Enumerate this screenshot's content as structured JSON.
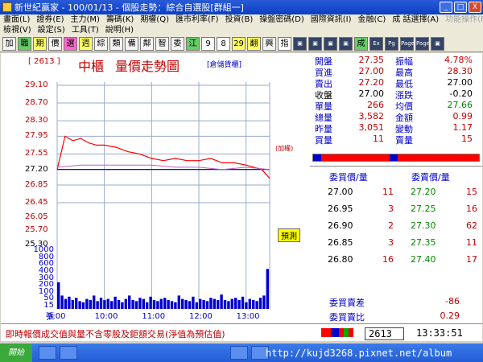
{
  "window": {
    "title": "新世紀贏家 - 100/01/13 - 個股走勢：綜合自選股[群組一]",
    "buttons": {
      "minimize": "_",
      "restore": "□",
      "close": "X"
    }
  },
  "menubar": {
    "row1": [
      "畫面(L)",
      "證券(E)",
      "主力(M)",
      "籌碼(K)",
      "期權(Q)",
      "匯市利率(F)",
      "投資(B)",
      "操盤密碼(D)",
      "國際資訊(I)",
      "金融(C)",
      "成 話選擇(A)",
      "功能操作(F)"
    ],
    "row2": [
      "檢視(V)",
      "設定(S)",
      "工具(T)",
      "說明(H)"
    ]
  },
  "toolbar": {
    "buttons": [
      "加",
      "職",
      "期",
      "價",
      "選",
      "週",
      "綜",
      "類",
      "備",
      "鄰",
      "智",
      "委",
      "江",
      "9",
      "8",
      "29",
      "翻",
      "興",
      "指",
      "▣",
      "▣",
      "▣",
      "▣",
      "成",
      "Ex",
      "Pg",
      "Page",
      "Page",
      "▣"
    ]
  },
  "chart": {
    "stock_code": "[ 2613 ]",
    "stock_name": "中櫃",
    "label": "量價走勢圖",
    "group_tag": "[倉儲貨櫃]",
    "plus_label": "(加權)",
    "estimate_badge": "預測",
    "volume_unit": "張"
  },
  "chart_data": {
    "type": "line",
    "price_ylim": [
      26.45,
      29.1
    ],
    "price_ticks": [
      "29.10",
      "28.70",
      "28.30",
      "27.95",
      "27.55",
      "27.20",
      "26.85",
      "26.45",
      "26.05",
      "25.70",
      "25.30"
    ],
    "reference_price": 27.2,
    "volume_ticks": [
      "1000",
      "800",
      "600",
      "400",
      "300",
      "200",
      "100",
      "50",
      "15"
    ],
    "x_ticks": [
      "9:00",
      "10:00",
      "11:00",
      "12:00",
      "13:00"
    ],
    "series": [
      {
        "name": "price",
        "color": "#ff0000",
        "x": [
          "9:00",
          "9:10",
          "9:20",
          "9:30",
          "9:40",
          "9:50",
          "10:00",
          "10:15",
          "10:30",
          "10:45",
          "11:00",
          "11:15",
          "11:30",
          "11:45",
          "12:00",
          "12:15",
          "12:30",
          "12:45",
          "13:00",
          "13:10",
          "13:20",
          "13:25",
          "13:30"
        ],
        "values": [
          27.2,
          27.95,
          27.85,
          27.9,
          27.8,
          27.75,
          27.75,
          27.7,
          27.6,
          27.55,
          27.45,
          27.4,
          27.45,
          27.4,
          27.4,
          27.45,
          27.35,
          27.35,
          27.3,
          27.25,
          27.2,
          27.1,
          27.0
        ]
      },
      {
        "name": "index",
        "color": "#c060c0",
        "x": [
          "9:00",
          "9:30",
          "10:00",
          "10:30",
          "11:00",
          "11:30",
          "12:00",
          "12:30",
          "13:00",
          "13:30"
        ],
        "values": [
          27.25,
          27.3,
          27.3,
          27.3,
          27.3,
          27.25,
          27.25,
          27.2,
          27.25,
          27.2
        ]
      }
    ],
    "volume_values": [
      120,
      60,
      45,
      55,
      40,
      50,
      35,
      30,
      45,
      40,
      60,
      35,
      50,
      40,
      45,
      35,
      55,
      40,
      30,
      45,
      60,
      40,
      35,
      50,
      45,
      30,
      55,
      40,
      35,
      45,
      50,
      40,
      35,
      30,
      60,
      45,
      40,
      35,
      55,
      30,
      45,
      40,
      35,
      50,
      45,
      40,
      65,
      40,
      35,
      45,
      50,
      40,
      55,
      30,
      45,
      40,
      35,
      50,
      60,
      180
    ]
  },
  "quote": {
    "rows": [
      {
        "l1": "開盤",
        "v1": "27.35",
        "l2": "振幅",
        "v2": "4.78%",
        "c2": "#c00000"
      },
      {
        "l1": "買進",
        "v1": "27.00",
        "l2": "最高",
        "v2": "28.30",
        "c2": "#c00000"
      },
      {
        "l1": "賣出",
        "v1": "27.20",
        "l2": "最低",
        "v2": "27.00",
        "c2": "#000000"
      },
      {
        "l1": "收盤",
        "v1": "27.00",
        "l2": "漲跌",
        "v2": "-0.20",
        "c2": "#000000"
      },
      {
        "l1": "單量",
        "v1": "266",
        "l2": "均價",
        "v2": "27.66",
        "c2": "#008800"
      },
      {
        "l1": "總量",
        "v1": "3,582",
        "l2": "金額",
        "v2": "0.99",
        "c2": "#c00000"
      },
      {
        "l1": "昨量",
        "v1": "3,051",
        "l2": "變動",
        "v2": "1.17",
        "c2": "#c00000"
      },
      {
        "l1": "買量",
        "v1": "11",
        "l2": "賣量",
        "v2": "15",
        "c2": "#c00000"
      }
    ],
    "bid_header": "委買價/量",
    "ask_header": "委賣價/量",
    "bids": [
      {
        "p": "27.00",
        "v": "11"
      },
      {
        "p": "26.95",
        "v": "3"
      },
      {
        "p": "26.90",
        "v": "2"
      },
      {
        "p": "26.85",
        "v": "3"
      },
      {
        "p": "26.80",
        "v": "16"
      }
    ],
    "asks": [
      {
        "p": "27.20",
        "v": "15"
      },
      {
        "p": "27.25",
        "v": "16"
      },
      {
        "p": "27.30",
        "v": "62"
      },
      {
        "p": "27.35",
        "v": "11"
      },
      {
        "p": "27.40",
        "v": "17"
      }
    ],
    "diff_label": "委買賣差",
    "diff_value": "-86",
    "ratio_label": "委買賣比",
    "ratio_value": "0.29"
  },
  "status": {
    "disclaimer": "即時報價成交值與量不含零股及鉅額交易(淨值為預估值)",
    "code": "2613",
    "time": "13:33:51"
  },
  "taskbar": {
    "start_label": "開始",
    "watermark": "http://kujd3268.pixnet.net/album"
  },
  "colors": {
    "titlebar": "#0a3fc4",
    "price": "#ff0000",
    "volume": "#0000cc",
    "grid": "#99aacc"
  }
}
